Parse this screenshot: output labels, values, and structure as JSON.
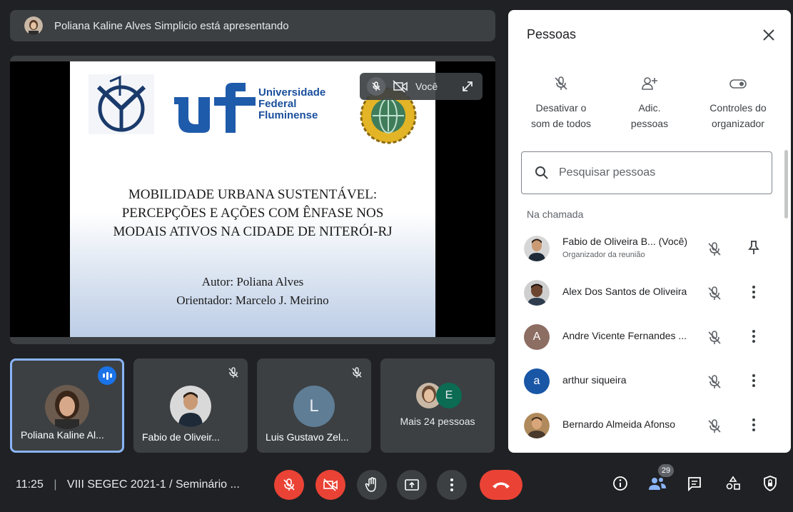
{
  "presenter_bar": {
    "text": "Poliana Kaline Alves Simplicio está apresentando"
  },
  "stage": {
    "slide": {
      "university_lines": [
        "Universidade",
        "Federal",
        "Fluminense"
      ],
      "title_lines": [
        "MOBILIDADE URBANA SUSTENTÁVEL:",
        "PERCEPÇÕES E AÇÕES COM ÊNFASE NOS",
        "MODAIS ATIVOS NA CIDADE DE NITERÓI-RJ"
      ],
      "author": "Autor: Poliana Alves",
      "advisor": "Orientador: Marcelo J. Meirino"
    },
    "self_view": {
      "label": "Você",
      "icons": [
        "mic-off-icon",
        "camera-off-icon",
        "expand-icon"
      ]
    }
  },
  "tiles": [
    {
      "name": "Poliana Kaline Al...",
      "speaking": true
    },
    {
      "name": "Fabio de Oliveir...",
      "muted": true
    },
    {
      "name": "Luis Gustavo Zel...",
      "muted": true,
      "initial": "L"
    },
    {
      "more_label": "Mais 24 pessoas",
      "initial": "E"
    }
  ],
  "panel": {
    "title": "Pessoas",
    "actions": [
      {
        "label_1": "Desativar o",
        "label_2": "som de todos",
        "icon": "mute-all-icon"
      },
      {
        "label_1": "Adic.",
        "label_2": "pessoas",
        "icon": "add-person-icon"
      },
      {
        "label_1": "Controles do",
        "label_2": "organizador",
        "icon": "toggle-icon"
      }
    ],
    "search": {
      "placeholder": "Pesquisar pessoas"
    },
    "section": "Na chamada",
    "people": [
      {
        "name": "Fabio de Oliveira B... (Você)",
        "subtitle": "Organizador da reunião",
        "action": "pin"
      },
      {
        "name": "Alex Dos Santos de Oliveira",
        "action": "more"
      },
      {
        "name": "Andre Vicente Fernandes ...",
        "initial": "A",
        "action": "more"
      },
      {
        "name": "arthur siqueira",
        "initial": "a",
        "action": "more"
      },
      {
        "name": "Bernardo Almeida Afonso",
        "action": "more"
      }
    ]
  },
  "bottom_bar": {
    "time": "11:25",
    "meeting_name": "VIII SEGEC 2021-1 / Seminário ...",
    "people_count": "29",
    "colors": {
      "danger": "#ea4335",
      "accent": "#1a73e8"
    }
  }
}
